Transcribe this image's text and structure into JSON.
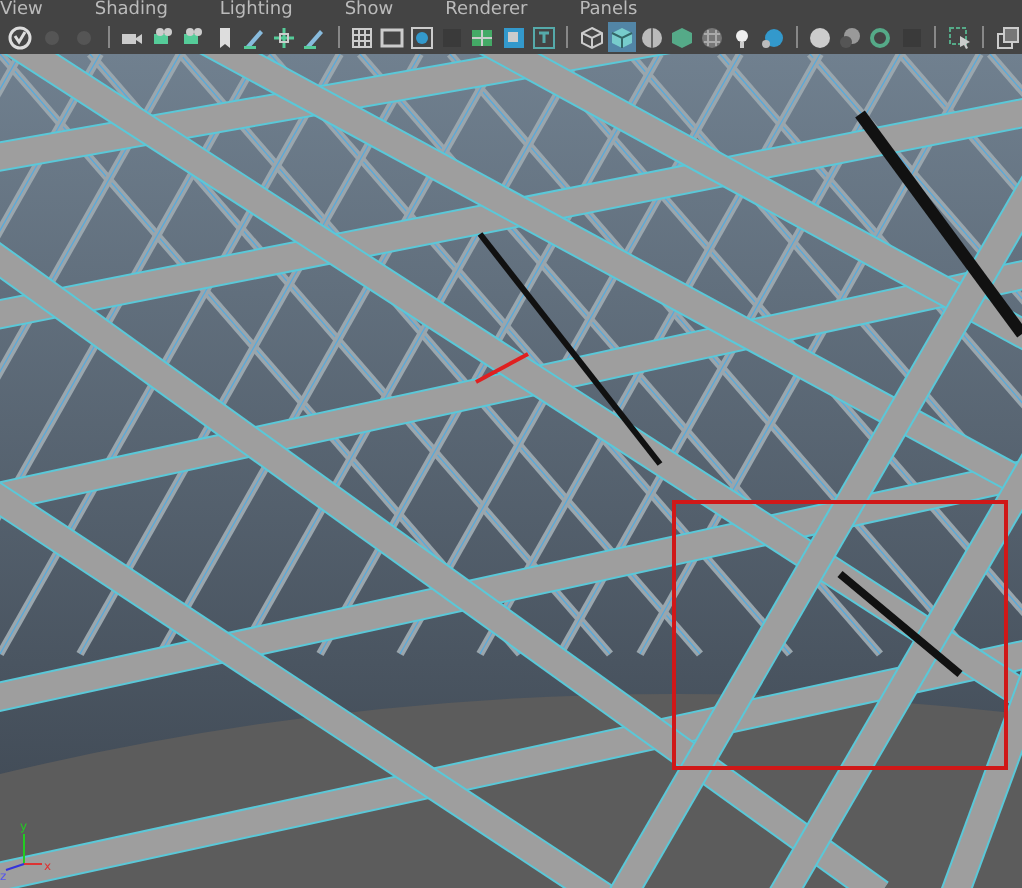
{
  "menu": [
    "View",
    "Shading",
    "Lighting",
    "Show",
    "Renderer",
    "Panels"
  ],
  "toolbar": {
    "groups": [
      [
        {
          "selected": false
        },
        {
          "selected": false
        },
        {
          "selected": false
        },
        {
          "selected": false
        },
        {
          "selected": false
        },
        {
          "selected": false
        },
        {
          "selected": false
        }
      ],
      [
        {
          "selected": false
        },
        {
          "selected": false
        },
        {
          "selected": false
        },
        {
          "selected": false
        },
        {
          "selected": false
        },
        {
          "selected": false
        },
        {
          "selected": false
        }
      ],
      [
        {
          "selected": false
        },
        {
          "selected": true
        },
        {
          "selected": false
        },
        {
          "selected": false
        },
        {
          "selected": false
        },
        {
          "selected": false
        },
        {
          "selected": false
        }
      ],
      [
        {
          "selected": false
        },
        {
          "selected": false
        },
        {
          "selected": false
        },
        {
          "selected": false
        }
      ],
      [
        {
          "selected": false
        }
      ],
      [
        {
          "selected": false
        }
      ]
    ]
  },
  "viewport": {
    "axes": [
      "x",
      "y",
      "z"
    ]
  }
}
